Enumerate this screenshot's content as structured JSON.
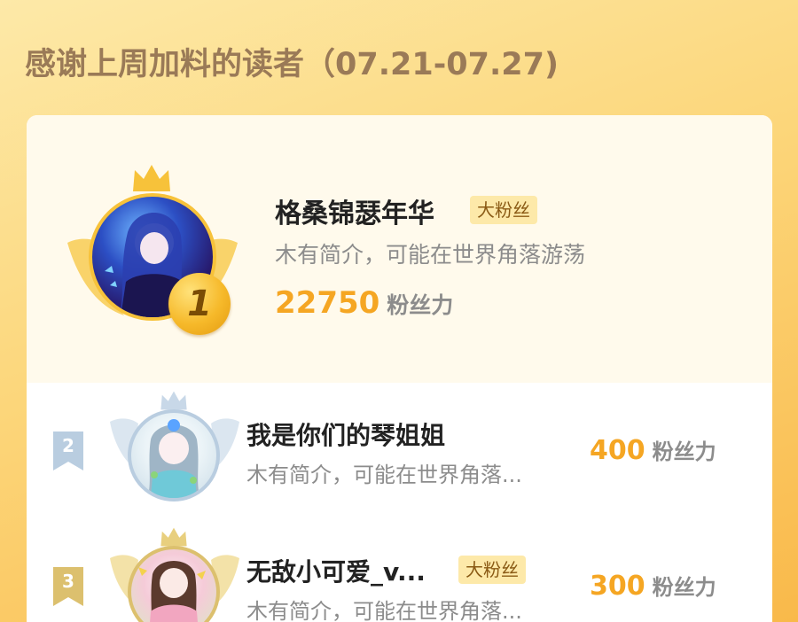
{
  "page": {
    "title": "感谢上周加料的读者（07.21-07.27)"
  },
  "ranking": [
    {
      "rank": "1",
      "name": "格桑锦瑟年华",
      "badge": "大粉丝",
      "intro": "木有简介，可能在世界角落游荡",
      "score": "22750",
      "unit": "粉丝力"
    },
    {
      "rank": "2",
      "name": "我是你们的琴姐姐",
      "badge": "",
      "intro": "木有简介，可能在世界角落...",
      "score": "400",
      "unit": "粉丝力"
    },
    {
      "rank": "3",
      "name": "无敌小可爱_v...",
      "badge": "大粉丝",
      "intro": "木有简介，可能在世界角落...",
      "score": "300",
      "unit": "粉丝力"
    }
  ],
  "colors": {
    "accent": "#f5a623",
    "title": "#9a7a57",
    "gold": "#f7c23a",
    "silver": "#b9cde0",
    "bronze": "#dcc06e"
  },
  "icons": {
    "rank1_decoration": "gold-crown-wings-icon",
    "rank2_decoration": "silver-crown-wings-icon",
    "rank3_decoration": "bronze-crown-wings-icon",
    "rank1_medal": "gold-medal-icon",
    "rank_ribbon": "rank-ribbon-icon"
  }
}
